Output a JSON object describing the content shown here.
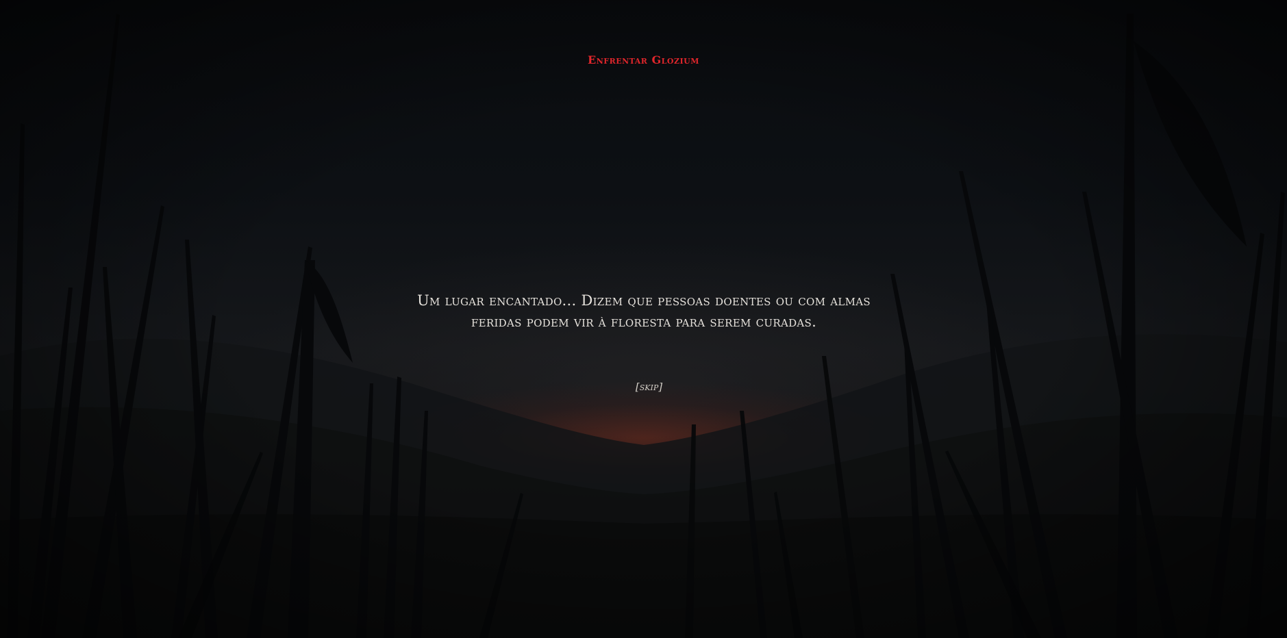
{
  "scene": {
    "top_action": "Enfrentar Glozium",
    "narration_line_1": "Um lugar encantado... Dizem que pessoas doentes ou com almas",
    "narration_line_2": "feridas podem vir à floresta para serem curadas.",
    "skip_label": "[skip]"
  },
  "colors": {
    "accent": "#e0262b",
    "text": "#e6e2dc",
    "background": "#0b0d10",
    "horizon_glow": "#782d1e"
  }
}
